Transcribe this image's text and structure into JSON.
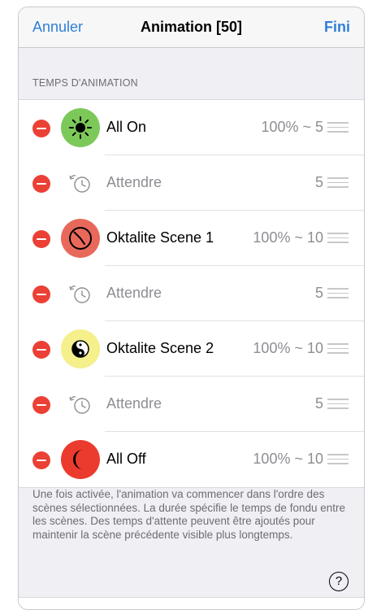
{
  "navbar": {
    "cancel_label": "Annuler",
    "title": "Animation [50]",
    "done_label": "Fini"
  },
  "section": {
    "header": "TEMPS D'ANIMATION"
  },
  "rows": [
    {
      "type": "scene",
      "icon": "sun-icon",
      "icon_color": "#7cc95a",
      "label": "All On",
      "value": "100% ~ 5"
    },
    {
      "type": "wait",
      "icon": "timer-icon",
      "label": "Attendre",
      "value": "5"
    },
    {
      "type": "scene",
      "icon": "clock-icon",
      "icon_color": "#e8695b",
      "label": "Oktalite Scene 1",
      "value": "100% ~ 10"
    },
    {
      "type": "wait",
      "icon": "timer-icon",
      "label": "Attendre",
      "value": "5"
    },
    {
      "type": "scene",
      "icon": "yin-yang-icon",
      "icon_color": "#f5ef8c",
      "label": "Oktalite Scene 2",
      "value": "100% ~ 10"
    },
    {
      "type": "wait",
      "icon": "timer-icon",
      "label": "Attendre",
      "value": "5"
    },
    {
      "type": "scene",
      "icon": "moon-icon",
      "icon_color": "#eb3b2e",
      "label": "All Off",
      "value": "100% ~ 10"
    }
  ],
  "footer": {
    "text": "Une fois activée, l'animation va commencer dans l'ordre des scènes sélectionnées. La durée spécifie le temps de fondu entre les scènes. Des temps d'attente peuvent être ajoutés pour maintenir la scène précédente visible plus longtemps.",
    "help_label": "?"
  },
  "colors": {
    "accent": "#2f7fd7",
    "delete": "#eb4035"
  }
}
